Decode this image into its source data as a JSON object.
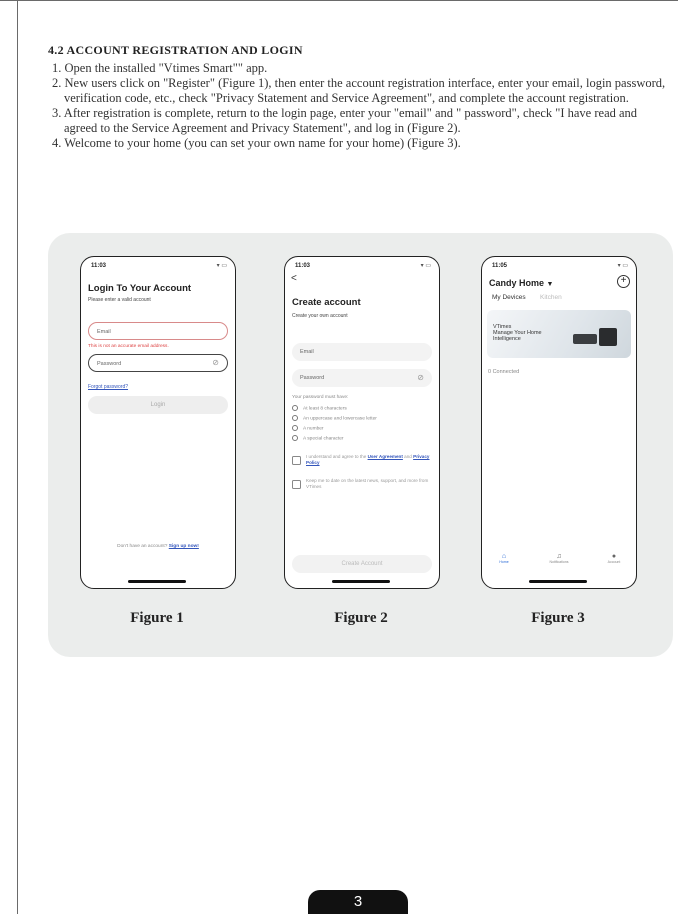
{
  "section": {
    "title": "4.2 ACCOUNT REGISTRATION AND LOGIN",
    "steps": [
      "1. Open the installed \"Vtimes Smart\"\" app.",
      "2. New users click on \"Register\" (Figure 1), then enter the account registration interface, enter your email, login password, verification code, etc., check \"Privacy Statement and Service Agreement\", and complete the account registration.",
      "3. After registration is complete, return to the login page, enter your \"email\" and \" password\", check \"I have read and agreed to the Service Agreement and Privacy Statement\", and log in (Figure 2).",
      "4. Welcome to your home (you can set your own name for your home) (Figure 3)."
    ]
  },
  "figure1": {
    "time": "11:03",
    "title": "Login To Your Account",
    "subtitle": "Please enter a valid account",
    "email_placeholder": "Email",
    "email_error": "This is not an accurate email address.",
    "password_placeholder": "Password",
    "forgot_link": "Forgot password?",
    "login_button": "Login",
    "signup_prompt": "Don't have an account?",
    "signup_link": "Sign up now!",
    "caption": "Figure 1"
  },
  "figure2": {
    "time": "11:03",
    "back": "<",
    "title": "Create account",
    "subtitle": "Create your own account",
    "email_placeholder": "Email",
    "password_placeholder": "Password",
    "rules_heading": "Your password must have:",
    "rules": [
      "At least 8 characters",
      "An uppercase and lowercase letter",
      "A number",
      "A special character"
    ],
    "agree_text": "I understand and agree to the",
    "agree_link1": "User Agreement",
    "agree_and": "and",
    "agree_link2": "Privacy Policy",
    "newsletter_text": "Keep me to date on the latest news, support, and more from VTimes",
    "create_button": "Create Account",
    "caption": "Figure 2"
  },
  "figure3": {
    "time": "11:05",
    "home_name": "Candy Home",
    "tabs": [
      "My Devices",
      "Kitchen"
    ],
    "banner_brand": "VTimes",
    "banner_line1": "Manage Your Home",
    "banner_line2": "Intelligence",
    "connected": "0 Connected",
    "nav": [
      "Home",
      "Notifications",
      "Account"
    ],
    "caption": "Figure 3"
  },
  "page_number": "3"
}
